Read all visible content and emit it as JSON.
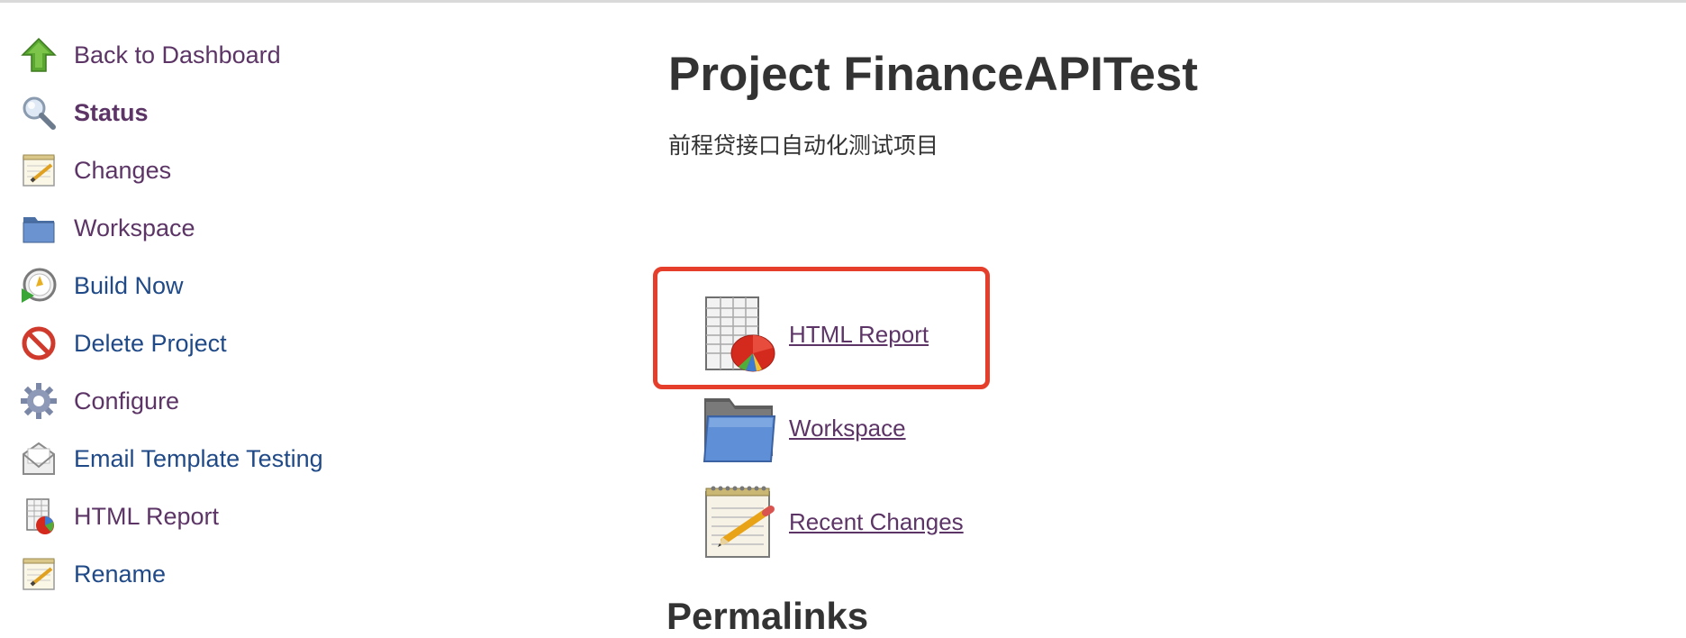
{
  "sidebar": {
    "items": [
      {
        "label": "Back to Dashboard",
        "icon": "up-arrow-icon"
      },
      {
        "label": "Status",
        "icon": "search-icon"
      },
      {
        "label": "Changes",
        "icon": "notepad-icon"
      },
      {
        "label": "Workspace",
        "icon": "folder-icon"
      },
      {
        "label": "Build Now",
        "icon": "clock-play-icon"
      },
      {
        "label": "Delete Project",
        "icon": "no-entry-icon"
      },
      {
        "label": "Configure",
        "icon": "gear-icon"
      },
      {
        "label": "Email Template Testing",
        "icon": "envelope-icon"
      },
      {
        "label": "HTML Report",
        "icon": "report-chart-icon"
      },
      {
        "label": "Rename",
        "icon": "notepad-icon"
      }
    ]
  },
  "main": {
    "title": "Project FinanceAPITest",
    "description": "前程贷接口自动化测试项目",
    "links": [
      {
        "label": "HTML Report",
        "icon": "report-chart-icon",
        "highlighted": true
      },
      {
        "label": "Workspace",
        "icon": "folder-icon"
      },
      {
        "label": "Recent Changes",
        "icon": "notepad-icon"
      }
    ],
    "partial_heading": "Permalinks"
  },
  "colors": {
    "link_purple": "#5c3566",
    "link_blue": "#204a87",
    "highlight_red": "#e53e2b",
    "text_dark": "#333333"
  }
}
